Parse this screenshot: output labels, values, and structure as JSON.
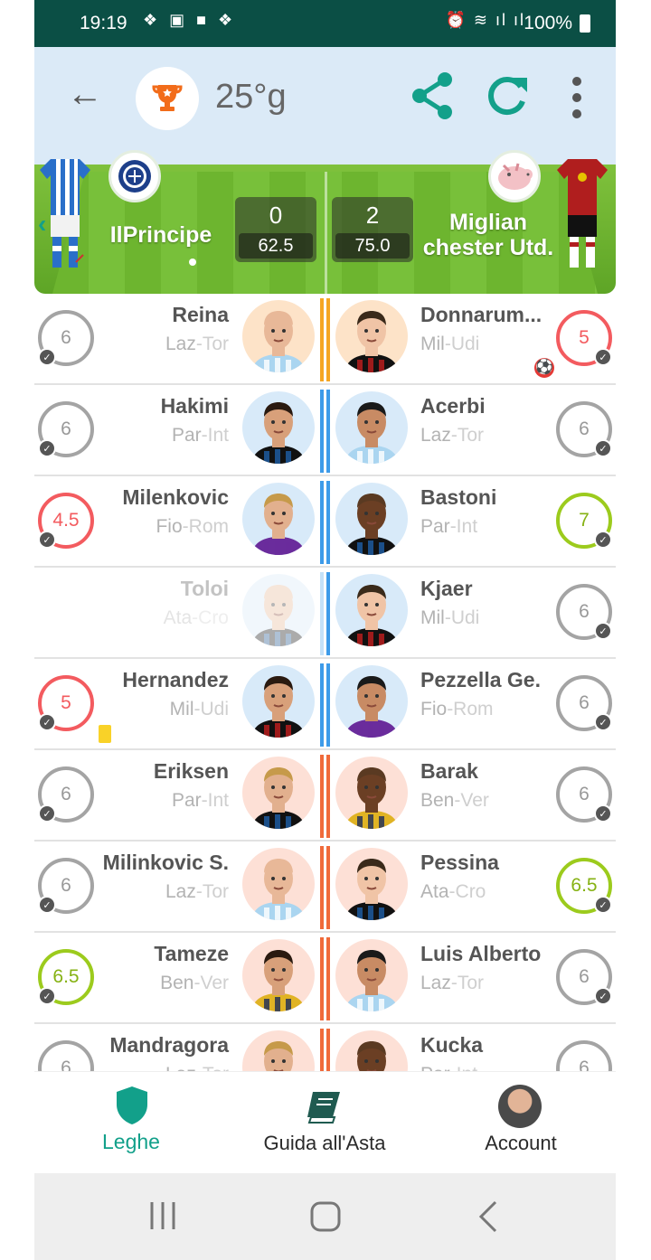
{
  "status_bar": {
    "time": "19:19",
    "battery": "100%"
  },
  "header": {
    "gameweek": "25°g"
  },
  "match": {
    "home": {
      "name": "IlPrincipe",
      "goals": "0",
      "points": "62.5"
    },
    "away": {
      "name": "Miglian chester Utd.",
      "goals": "2",
      "points": "75.0"
    }
  },
  "lineup": [
    {
      "home": {
        "name": "Reina",
        "team_a": "Laz",
        "team_b": "-Tor",
        "rating": "6",
        "style": "grey"
      },
      "away": {
        "name": "Donnarum...",
        "team_a": "Mil",
        "team_b": "-Udi",
        "rating": "5",
        "style": "red",
        "goal_conceded": true
      },
      "bar_color": "#f5a623"
    },
    {
      "home": {
        "name": "Hakimi",
        "team_a": "Par",
        "team_b": "-Int",
        "rating": "6",
        "style": "grey"
      },
      "away": {
        "name": "Acerbi",
        "team_a": "Laz",
        "team_b": "-Tor",
        "rating": "6",
        "style": "grey"
      },
      "bar_color": "#3d9be9"
    },
    {
      "home": {
        "name": "Milenkovic",
        "team_a": "Fio",
        "team_b": "-Rom",
        "rating": "4.5",
        "style": "red"
      },
      "away": {
        "name": "Bastoni",
        "team_a": "Par",
        "team_b": "-Int",
        "rating": "7",
        "style": "green"
      },
      "bar_color": "#3d9be9"
    },
    {
      "home": {
        "name": "Toloi",
        "team_a": "Ata",
        "team_b": "-Cro",
        "rating": "",
        "style": "none",
        "dim": true
      },
      "away": {
        "name": "Kjaer",
        "team_a": "Mil",
        "team_b": "-Udi",
        "rating": "6",
        "style": "grey"
      },
      "bar_color": "#3d9be9"
    },
    {
      "home": {
        "name": "Hernandez",
        "team_a": "Mil",
        "team_b": "-Udi",
        "rating": "5",
        "style": "red",
        "yellow_card": true
      },
      "away": {
        "name": "Pezzella Ge.",
        "team_a": "Fio",
        "team_b": "-Rom",
        "rating": "6",
        "style": "grey"
      },
      "bar_color": "#3d9be9"
    },
    {
      "home": {
        "name": "Eriksen",
        "team_a": "Par",
        "team_b": "-Int",
        "rating": "6",
        "style": "grey"
      },
      "away": {
        "name": "Barak",
        "team_a": "Ben",
        "team_b": "-Ver",
        "rating": "6",
        "style": "grey"
      },
      "bar_color": "#f06a3a"
    },
    {
      "home": {
        "name": "Milinkovic S.",
        "team_a": "Laz",
        "team_b": "-Tor",
        "rating": "6",
        "style": "grey"
      },
      "away": {
        "name": "Pessina",
        "team_a": "Ata",
        "team_b": "-Cro",
        "rating": "6.5",
        "style": "green"
      },
      "bar_color": "#f06a3a"
    },
    {
      "home": {
        "name": "Tameze",
        "team_a": "Ben",
        "team_b": "-Ver",
        "rating": "6.5",
        "style": "green"
      },
      "away": {
        "name": "Luis Alberto",
        "team_a": "Laz",
        "team_b": "-Tor",
        "rating": "6",
        "style": "grey"
      },
      "bar_color": "#f06a3a"
    },
    {
      "home": {
        "name": "Mandragora",
        "team_a": "Laz",
        "team_b": "-Tor",
        "rating": "6",
        "style": "grey"
      },
      "away": {
        "name": "Kucka",
        "team_a": "Par",
        "team_b": "-Int",
        "rating": "6",
        "style": "grey"
      },
      "bar_color": "#f06a3a"
    }
  ],
  "bottom_nav": [
    {
      "label": "Leghe",
      "icon": "shield-icon",
      "active": true
    },
    {
      "label": "Guida all'Asta",
      "icon": "book-icon"
    },
    {
      "label": "Account",
      "icon": "avatar"
    }
  ],
  "colors": {
    "accent": "#12a08a",
    "red_rating": "#f35b5f",
    "green_rating": "#9ccb1d",
    "grey_rating": "#a4a4a4",
    "status_bar": "#0b4f45"
  }
}
